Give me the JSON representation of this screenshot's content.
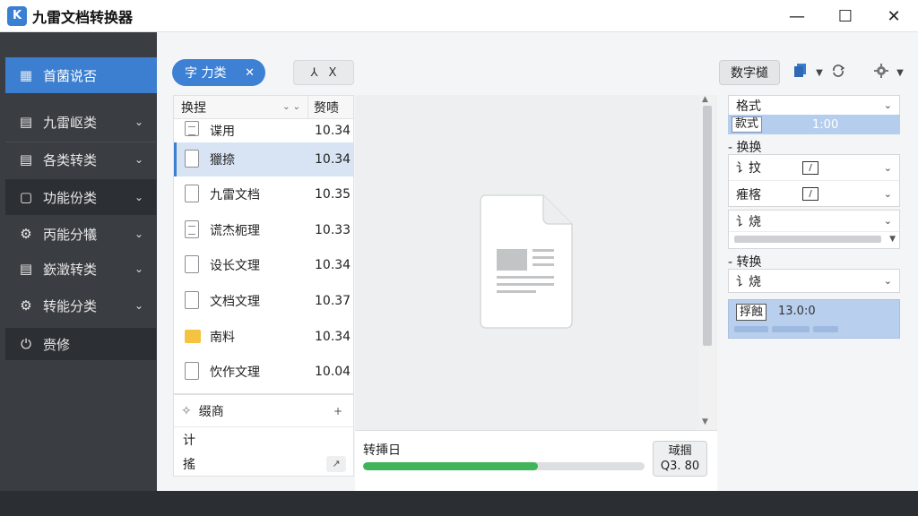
{
  "window": {
    "title": "九雷文档转换器",
    "logo_glyph": "K",
    "minimize": "—",
    "maximize": "☐",
    "close": "✕"
  },
  "sidebar": {
    "items": [
      {
        "label": "首菌说否",
        "icon": "grid-icon",
        "glyph": "▦",
        "active": true
      },
      {
        "label": "九雷岖类",
        "icon": "chart-doc-icon",
        "glyph": "▤"
      },
      {
        "label": "各类转类",
        "icon": "list-doc-icon",
        "glyph": "▤"
      },
      {
        "label": "功能份类",
        "icon": "doc-icon",
        "glyph": "▢"
      },
      {
        "label": "丙能分犠",
        "icon": "gear-icon",
        "glyph": "⚙"
      },
      {
        "label": "嶔澂转类",
        "icon": "file-icon",
        "glyph": "▤"
      },
      {
        "label": "转能分类",
        "icon": "cog-icon",
        "glyph": "⚙"
      },
      {
        "label": "赍修",
        "icon": "power-icon",
        "glyph": "⏻"
      }
    ],
    "chevron": "⌄"
  },
  "toolbar": {
    "chip_label": "字 力类",
    "chip_close": "✕",
    "tool_a": "⅄",
    "tool_b": "X",
    "right_button": "数字檤"
  },
  "file_list": {
    "header_name": "换捏",
    "header_sort": "⌄ ⌄",
    "header_size": "赘啧",
    "rows": [
      {
        "name": "谍用",
        "size": "10.34",
        "type": "doc"
      },
      {
        "name": "獵捺",
        "size": "10.34",
        "type": "doc",
        "selected": true
      },
      {
        "name": "九雷文档",
        "size": "10.35",
        "type": "doc"
      },
      {
        "name": "谎杰枙理",
        "size": "10.33",
        "type": "doc"
      },
      {
        "name": "设长文理",
        "size": "10.34",
        "type": "doc"
      },
      {
        "name": "文档文理",
        "size": "10.37",
        "type": "doc"
      },
      {
        "name": "南料",
        "size": "10.34",
        "type": "folder"
      },
      {
        "name": "忺作文理",
        "size": "10.04",
        "type": "doc"
      }
    ]
  },
  "favorites": {
    "title": "缀商",
    "plus": "+",
    "line1": "计",
    "line2": "搖",
    "trend": "↗"
  },
  "progress": {
    "label": "转挿日",
    "percent": 62,
    "button_line1": "琙掴",
    "button_line2": "Q3. 80"
  },
  "settings": {
    "format_label": "格式",
    "format_tag": "款式",
    "format_value": "1:00",
    "section1_title": "- 换换",
    "row1_label": "讠抆",
    "row1_check": "/",
    "row2_label": "痽楁",
    "row2_check": "/",
    "row3_label": "讠烧",
    "section2_title": "- 转换",
    "select2_label": "讠烧",
    "result_tag": "捊蝕",
    "result_value": "13.0:0"
  }
}
